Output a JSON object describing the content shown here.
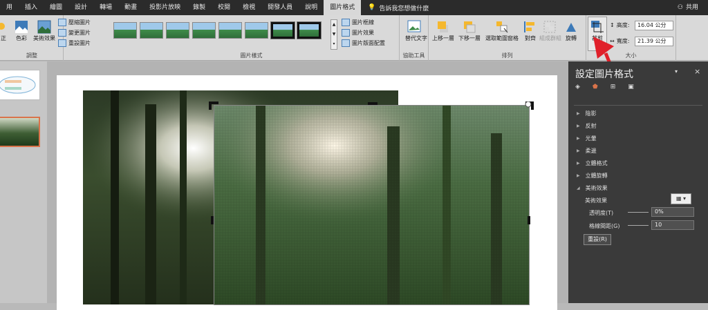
{
  "tabs": [
    "用",
    "插入",
    "繪圖",
    "設計",
    "轉場",
    "動畫",
    "投影片放映",
    "錄製",
    "校閱",
    "檢視",
    "開發人員",
    "說明",
    "圖片格式"
  ],
  "tell_me": "告訴我您想做什麼",
  "share": "共用",
  "ribbon": {
    "adjust": {
      "label": "調整",
      "correct": "正",
      "color": "色彩",
      "artistic": "美術效果",
      "compress": "壓縮圖片",
      "change": "變更圖片",
      "reset": "重設圖片"
    },
    "styles": {
      "label": "圖片樣式",
      "border": "圖片框線",
      "effects": "圖片效果",
      "layout": "圖片版面配置"
    },
    "access": {
      "label": "協助工具",
      "alt_text": "替代文字"
    },
    "arrange": {
      "label": "排列",
      "forward": "上移一層",
      "backward": "下移一層",
      "selection": "選取範圍窗格",
      "align": "對齊",
      "group": "組成群組",
      "rotate": "旋轉"
    },
    "size": {
      "label": "大小",
      "crop": "裁剪",
      "height_label": "高度:",
      "height": "16.04 公分",
      "width_label": "寬度:",
      "width": "21.39 公分"
    }
  },
  "pane": {
    "title": "設定圖片格式",
    "sections": [
      "陰影",
      "反射",
      "光暈",
      "柔邊",
      "立體格式",
      "立體旋轉",
      "美術效果"
    ],
    "artistic_label": "美術效果",
    "transparency_label": "透明度(T)",
    "transparency": "0%",
    "grid_label": "格線間距(G)",
    "grid": "10",
    "reset": "重設(R)"
  },
  "colors": {
    "accent": "#d9734a",
    "red_arrow": "#e0202a"
  }
}
